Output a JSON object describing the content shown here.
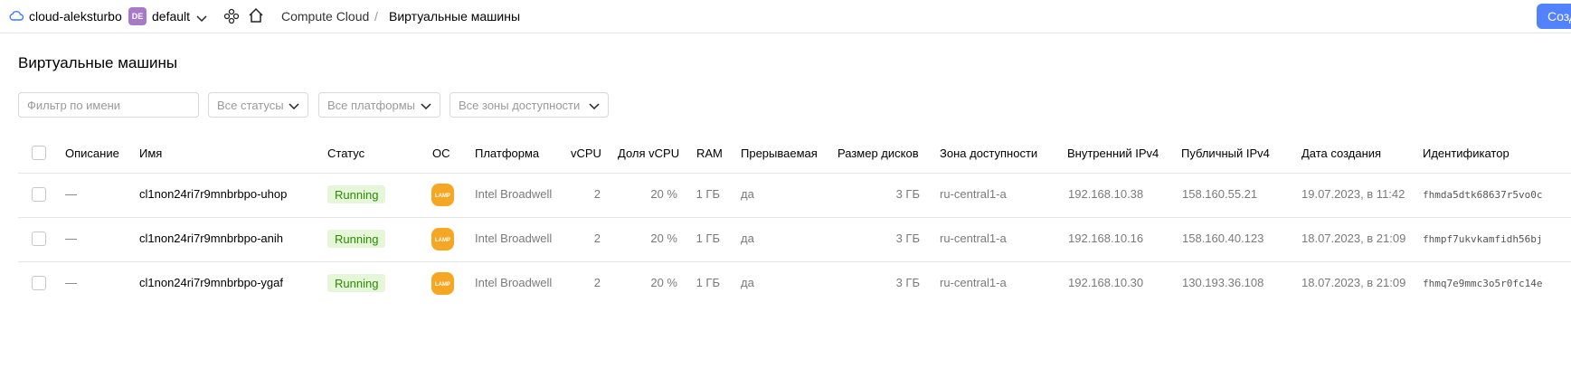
{
  "header": {
    "cloud_name": "cloud-aleksturbo",
    "folder_badge": "DE",
    "folder_name": "default",
    "service": "Compute Cloud",
    "separator": "/",
    "current": "Виртуальные машины",
    "create_button": "Созд"
  },
  "page": {
    "title": "Виртуальные машины"
  },
  "filters": {
    "name_placeholder": "Фильтр по имени",
    "status": "Все статусы",
    "platform": "Все платформы",
    "zone": "Все зоны доступности"
  },
  "table": {
    "columns": {
      "description": "Описание",
      "name": "Имя",
      "status": "Статус",
      "os": "ОС",
      "platform": "Платформа",
      "vcpu": "vCPU",
      "vcpu_share": "Доля vCPU",
      "ram": "RAM",
      "preemptible": "Прерываемая",
      "disk_size": "Размер дисков",
      "zone": "Зона доступности",
      "internal_ip": "Внутренний IPv4",
      "public_ip": "Публичный IPv4",
      "created": "Дата создания",
      "id": "Идентификатор"
    },
    "rows": [
      {
        "description": "—",
        "name": "cl1non24ri7r9mnbrbpo-uhop",
        "status": "Running",
        "os": "LAMP",
        "platform": "Intel Broadwell",
        "vcpu": "2",
        "vcpu_share": "20 %",
        "ram": "1 ГБ",
        "preemptible": "да",
        "disk_size": "3 ГБ",
        "zone": "ru-central1-a",
        "internal_ip": "192.168.10.38",
        "public_ip": "158.160.55.21",
        "created": "19.07.2023, в 11:42",
        "id": "fhmda5dtk68637r5vo0c"
      },
      {
        "description": "—",
        "name": "cl1non24ri7r9mnbrbpo-anih",
        "status": "Running",
        "os": "LAMP",
        "platform": "Intel Broadwell",
        "vcpu": "2",
        "vcpu_share": "20 %",
        "ram": "1 ГБ",
        "preemptible": "да",
        "disk_size": "3 ГБ",
        "zone": "ru-central1-a",
        "internal_ip": "192.168.10.16",
        "public_ip": "158.160.40.123",
        "created": "18.07.2023, в 21:09",
        "id": "fhmpf7ukvkamfidh56bj"
      },
      {
        "description": "—",
        "name": "cl1non24ri7r9mnbrbpo-ygaf",
        "status": "Running",
        "os": "LAMP",
        "platform": "Intel Broadwell",
        "vcpu": "2",
        "vcpu_share": "20 %",
        "ram": "1 ГБ",
        "preemptible": "да",
        "disk_size": "3 ГБ",
        "zone": "ru-central1-a",
        "internal_ip": "192.168.10.30",
        "public_ip": "130.193.36.108",
        "created": "18.07.2023, в 21:09",
        "id": "fhmq7e9mmc3o5r0fc14e"
      }
    ]
  },
  "colors": {
    "accent": "#5282ff",
    "status_bg": "#e6f7d9",
    "status_text": "#2b8a00",
    "lamp": "#f5a623",
    "badge": "#a879c6"
  }
}
